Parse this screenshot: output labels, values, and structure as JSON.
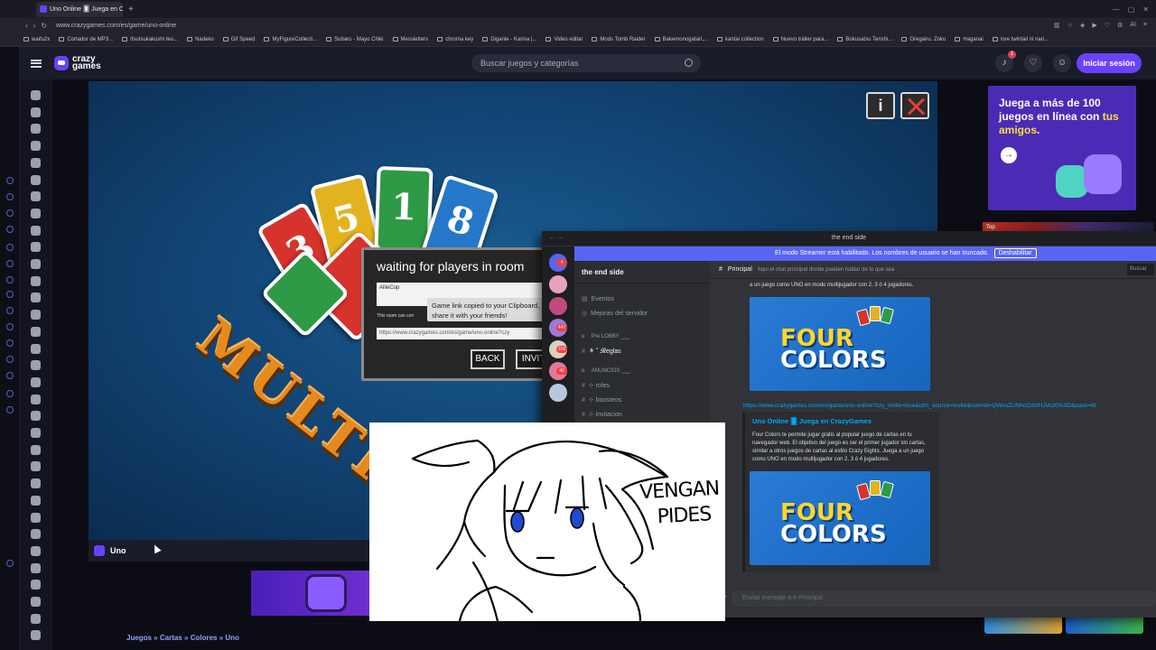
{
  "browser": {
    "tab_title": "Uno Online 🂠 Juega en Cr...",
    "new_tab": "+",
    "url": "www.crazygames.com/es/game/uno-online",
    "bookmarks": [
      "waifu2x",
      "Cortador de MP3...",
      "/tsutsukakushi teu...",
      "Nadeko",
      "Gif Speed",
      "MyFigureCollecti...",
      "Subaru - Mayo Chiki",
      "Messletters",
      "chroma key",
      "Diganle - Karina |...",
      "Video editar",
      "Mods Tomb Raider",
      "Bakemonogatari,...",
      "kantai collection",
      "Nuevo tráiler para...",
      "Bokusatsu Tenshi...",
      "Oregairu. Zoku",
      "Haganai",
      "/ore twintail ni nari..."
    ],
    "ai_label": "AI"
  },
  "crazygames": {
    "logo_text": "crazy games",
    "search_placeholder": "Buscar juegos y categorías",
    "notification_count": "1",
    "login_label": "Iniciar sesión",
    "game_title": "Uno",
    "breadcrumb": "Juegos » Cartas » Colores » Uno",
    "promo_text_1": "Juega a más de 100 juegos en línea con ",
    "promo_text_highlight": "tus amigos",
    "promo_text_2": ".",
    "top_badge": "Top"
  },
  "game": {
    "info_button": "i",
    "card_numbers": [
      "3",
      "5",
      "1",
      "8"
    ],
    "multiplayer_text": "MULTIPLA",
    "dialog_title": "waiting for players in room",
    "player_name": "AllieCop",
    "room_note": "This room can con",
    "tooltip_text": "Game link copied to your Clipboard, share it with your friends!",
    "room_url": "https://www.crazygames.com/es/game/uno-online?czy",
    "back_button": "BACK",
    "invite_button": "INVITE"
  },
  "discord": {
    "window_title": "the end side",
    "streamer_banner": "El modo Streamer está habilitado. Los nombres de usuario se han truncado.",
    "disable_button": "Deshabilitar",
    "guild_name": "the end side",
    "server_badges": [
      "4",
      "447",
      "316",
      "40"
    ],
    "channels": {
      "events": "Eventos",
      "boosts": "Mejoras del servidor",
      "cat_lobby": "ʚ ⠀ Pre LOBBY ‿‿",
      "ch_reglas": "⚘ ˚ 𝓡eglas",
      "cat_anuncios": "ʚ ⠀ ANUNCIOS ‿‿",
      "ch_roles": "⊹ roles",
      "ch_boosteos": "⊹ boosteos",
      "ch_invitacion": "⊹ invitacion"
    },
    "channel_header": "Principal",
    "channel_topic": "Aqui el chat principal donde pueden hablar de lo que sea",
    "search_label": "Buscar",
    "message_snippet": "a un juego como UNO en modo multijugador con 2, 3 ó 4 jugadores.",
    "image_title_1": "FOUR",
    "image_title_2": "COLORS",
    "invite_link": "https://www.crazygames.com/es/game/uno-online?czy_invite=true&utm_source=invite&roomid=QWxsZUNhcCdzIHJvb20%3D&pass=M",
    "embed_title": "Uno Online 🂠 Juega en CrazyGames",
    "embed_desc": "Four Colors te permite jugar gratis al popular juego de cartas en tu navegador web. El objetivo del juego es ser el primer jugador sin cartas, similar a otros juegos de cartas al estilo Crazy Eights. Juega a un juego como UNO en modo multijugador con 2, 3 ó 4 jugadores.",
    "input_placeholder": "Enviar mensaje a #·Principal"
  },
  "drawing": {
    "caption_line1": "VENGAN",
    "caption_line2": "PIDES"
  }
}
